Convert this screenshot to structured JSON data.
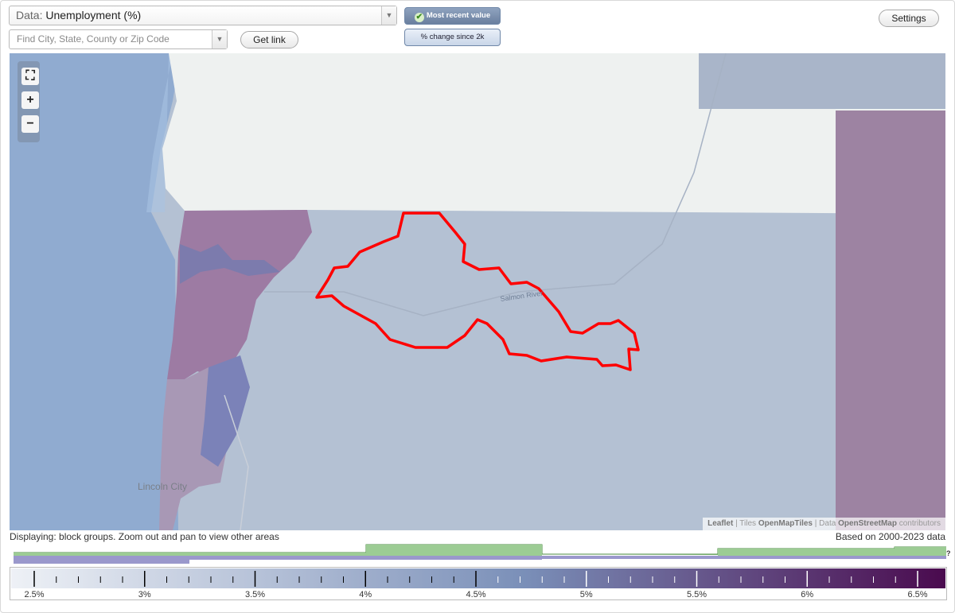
{
  "controls": {
    "data_label": "Data:",
    "data_value": "Unemployment (%)",
    "search_placeholder": "Find City, State, County or Zip Code",
    "get_link": "Get link",
    "most_recent": "Most recent value",
    "pct_change": "% change since 2k",
    "settings": "Settings"
  },
  "map": {
    "city_label": "Lincoln City",
    "river_label": "Salmon River",
    "zoom_in": "+",
    "zoom_out": "−",
    "attribution": {
      "leaflet": "Leaflet",
      "sep1": " | Tiles ",
      "tiles": "OpenMapTiles",
      "sep2": " | Data ",
      "data": "OpenStreetMap",
      "contributors": " contributors"
    }
  },
  "footer": {
    "displaying": "Displaying: block groups. Zoom out and pan to view other areas",
    "based_on": "Based on 2000-2023 data",
    "question": "?"
  },
  "legend": {
    "ticks": [
      "2.5%",
      "3%",
      "3.5%",
      "4%",
      "4.5%",
      "5%",
      "5.5%",
      "6%",
      "6.5%"
    ],
    "min": 2.3,
    "max": 6.75,
    "colors": {
      "low": "#eef1f6",
      "mid": "#7a8fb8",
      "high": "#4a0a4e"
    },
    "highlight_color": "#ff0000"
  }
}
